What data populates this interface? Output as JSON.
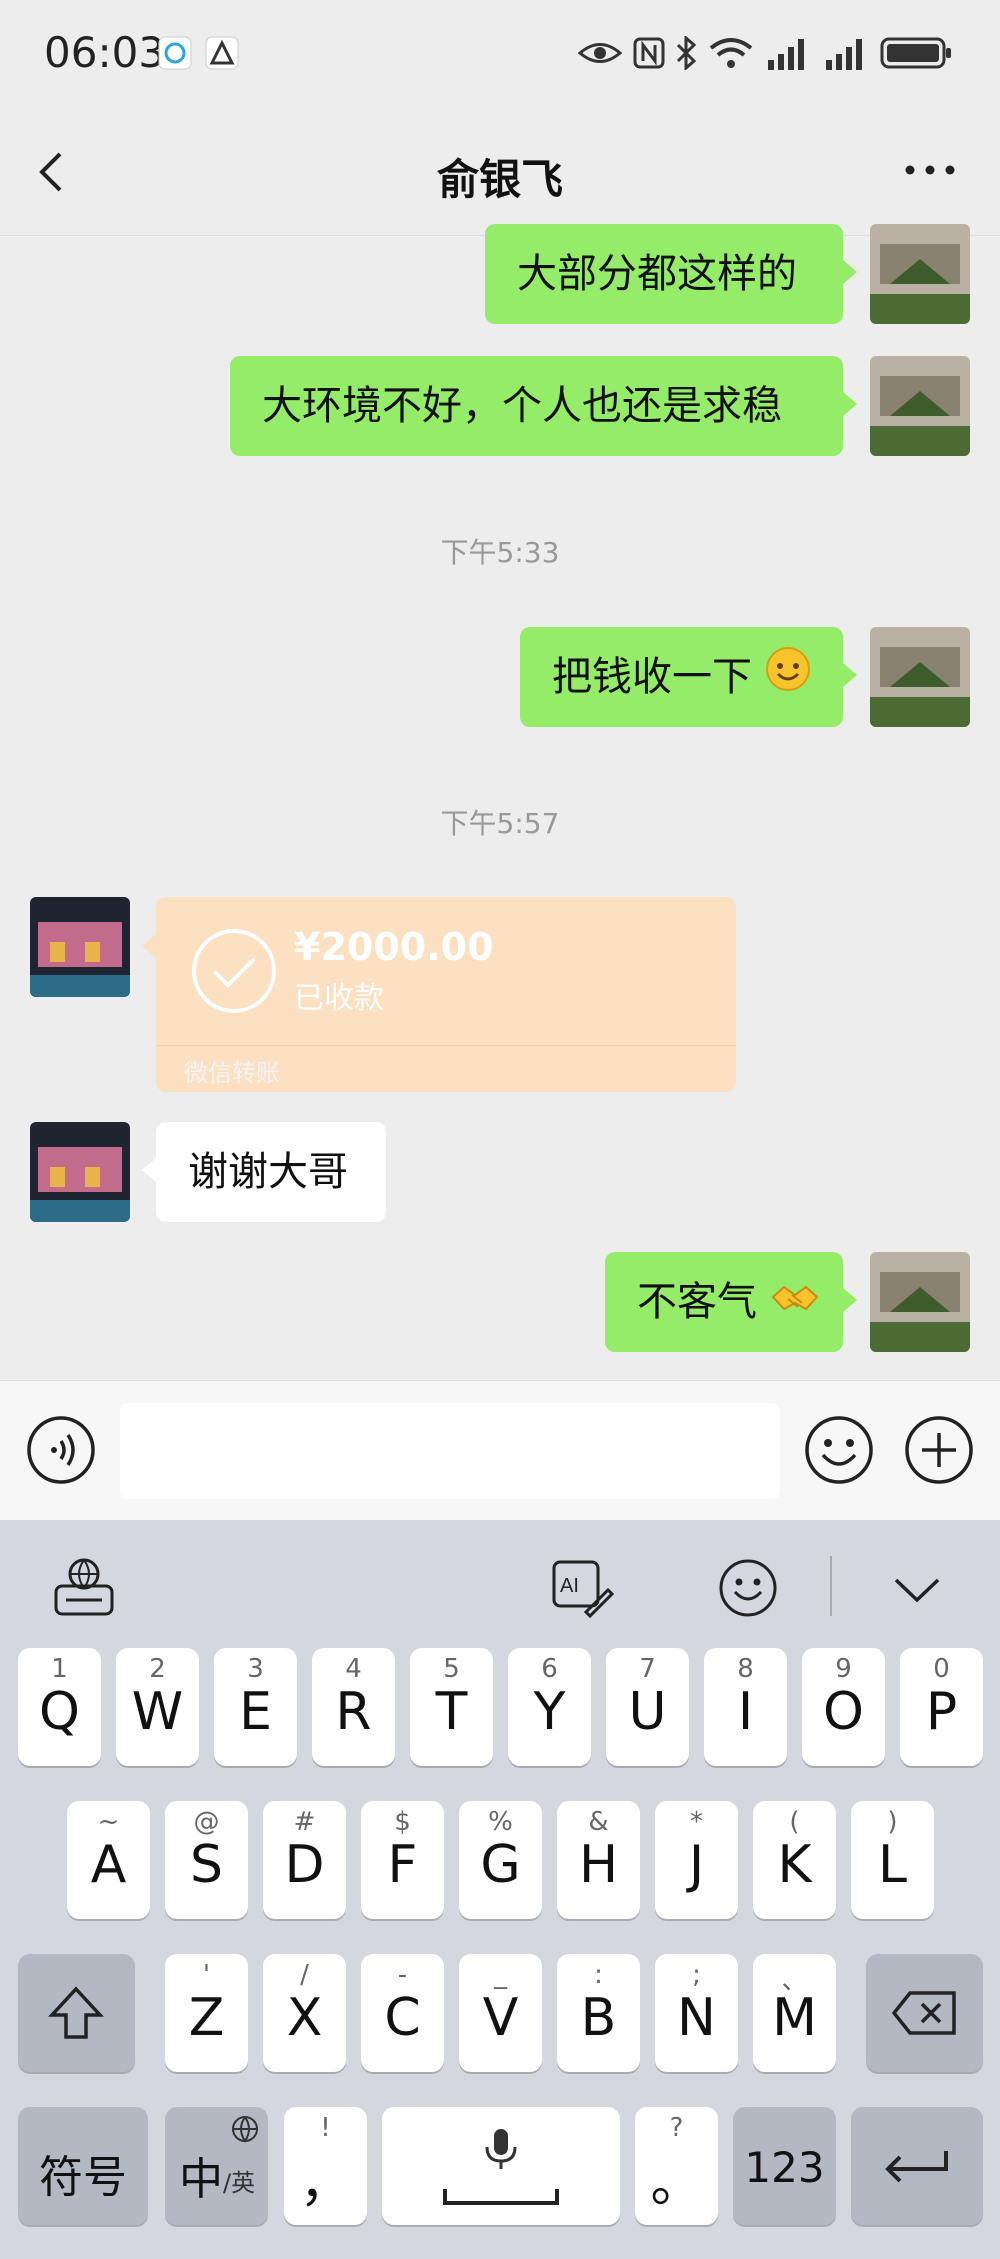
{
  "status_bar": {
    "time": "06:03"
  },
  "header": {
    "title": "俞银飞"
  },
  "messages": {
    "m1": "大部分都这样的",
    "m2": "大环境不好，个人也还是求稳",
    "ts1": "下午5:33",
    "m3": "把钱收一下",
    "ts2": "下午5:57",
    "transfer": {
      "amount": "¥2000.00",
      "status": "已收款",
      "source": "微信转账"
    },
    "m4": "谢谢大哥",
    "m5": "不客气"
  },
  "colors": {
    "sent_bubble": "#95ec69",
    "received_bubble": "#ffffff",
    "transfer_bg": "#fce0c2",
    "background": "#ededed"
  },
  "keyboard": {
    "row1": [
      {
        "hint": "1",
        "key": "Q"
      },
      {
        "hint": "2",
        "key": "W"
      },
      {
        "hint": "3",
        "key": "E"
      },
      {
        "hint": "4",
        "key": "R"
      },
      {
        "hint": "5",
        "key": "T"
      },
      {
        "hint": "6",
        "key": "Y"
      },
      {
        "hint": "7",
        "key": "U"
      },
      {
        "hint": "8",
        "key": "I"
      },
      {
        "hint": "9",
        "key": "O"
      },
      {
        "hint": "0",
        "key": "P"
      }
    ],
    "row2": [
      {
        "hint": "~",
        "key": "A"
      },
      {
        "hint": "@",
        "key": "S"
      },
      {
        "hint": "#",
        "key": "D"
      },
      {
        "hint": "$",
        "key": "F"
      },
      {
        "hint": "%",
        "key": "G"
      },
      {
        "hint": "&",
        "key": "H"
      },
      {
        "hint": "*",
        "key": "J"
      },
      {
        "hint": "(",
        "key": "K"
      },
      {
        "hint": ")",
        "key": "L"
      }
    ],
    "row3": [
      {
        "hint": "'",
        "key": "Z"
      },
      {
        "hint": "/",
        "key": "X"
      },
      {
        "hint": "-",
        "key": "C"
      },
      {
        "hint": "_",
        "key": "V"
      },
      {
        "hint": ":",
        "key": "B"
      },
      {
        "hint": ";",
        "key": "N"
      },
      {
        "hint": "、",
        "key": "M"
      }
    ],
    "symbols": "符号",
    "lang_main": "中",
    "lang_sub": "/英",
    "comma": "，",
    "comma_hint": "!",
    "period": "。",
    "period_hint": "?",
    "num": "123"
  }
}
